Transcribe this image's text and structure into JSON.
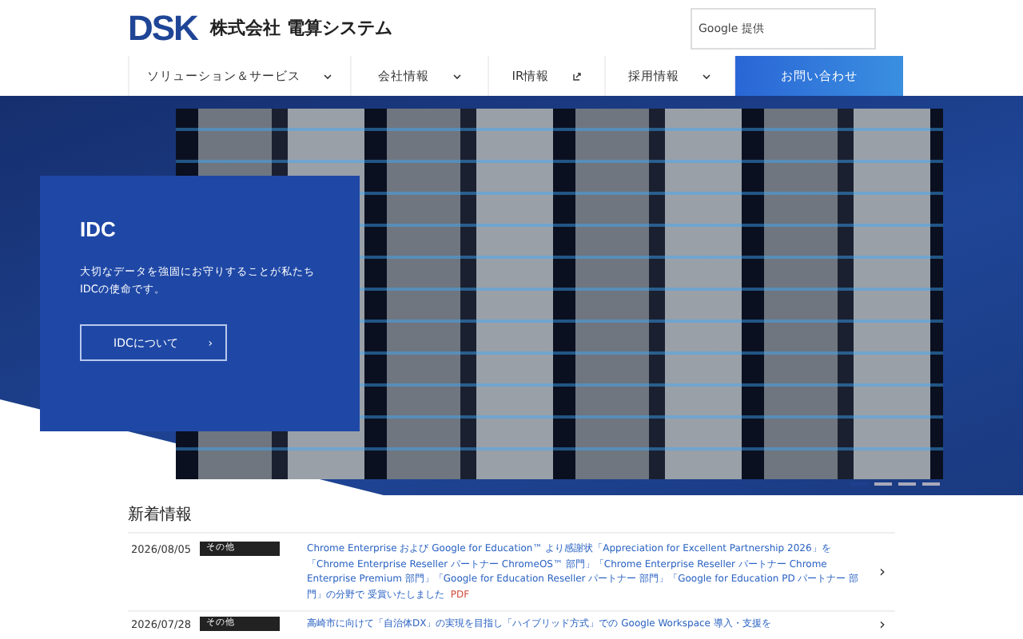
{
  "header": {
    "logo": "DSK",
    "company": "株式会社 電算システム",
    "search": {
      "placeholder": "Google 提供"
    }
  },
  "nav": [
    {
      "label": "ソリューション＆サービス",
      "kind": "dropdown"
    },
    {
      "label": "会社情報",
      "kind": "dropdown"
    },
    {
      "label": "IR情報",
      "kind": "external"
    },
    {
      "label": "採用情報",
      "kind": "dropdown"
    },
    {
      "label": "お問い合わせ",
      "kind": "cta"
    }
  ],
  "hero": {
    "title": "IDC",
    "text": "大切なデータを強固にお守りすることが私たちIDCの使命です。",
    "button": "IDCについて",
    "chevron": "›",
    "slides": [
      {
        "selected": true
      },
      {
        "selected": false
      },
      {
        "selected": false
      },
      {
        "selected": false
      }
    ]
  },
  "news": {
    "title": "新着情報",
    "items": [
      {
        "date": "2026/08/05",
        "tag": "その他",
        "text": "Chrome Enterprise および Google for Education™ より感謝状「Appreciation for Excellent Partnership 2026」を「Chrome Enterprise Reseller パートナー ChromeOS™ 部門」「Chrome Enterprise Reseller パートナー Chrome Enterprise Premium 部門」「Google for Education Reseller パートナー 部門」「Google for Education PD パートナー 部門」の分野で 受賞いたしました",
        "pdf": "PDF",
        "chevron": "›"
      },
      {
        "date": "2026/07/28",
        "tag": "その他",
        "text": "高崎市に向けて「自治体DX」の実現を目指し「ハイブリッド方式」での Google Workspace 導入・支援を",
        "chevron": "›"
      }
    ]
  }
}
